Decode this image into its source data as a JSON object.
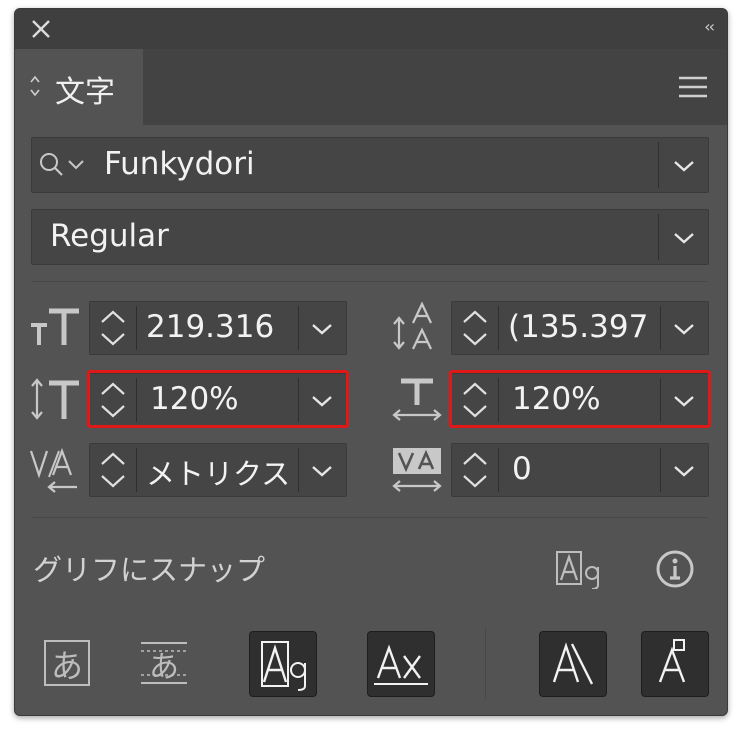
{
  "panel": {
    "tab_label": "文字",
    "collapse_glyph": "‹‹"
  },
  "font": {
    "family": "Funkydori",
    "style": "Regular"
  },
  "metrics": {
    "font_size": "219.316",
    "leading": "(135.397",
    "vertical_scale": "120%",
    "horizontal_scale": "120%",
    "kerning": "メトリクス",
    "tracking": "0"
  },
  "snap": {
    "label": "グリフにスナップ"
  },
  "highlight_color": "#e01818"
}
